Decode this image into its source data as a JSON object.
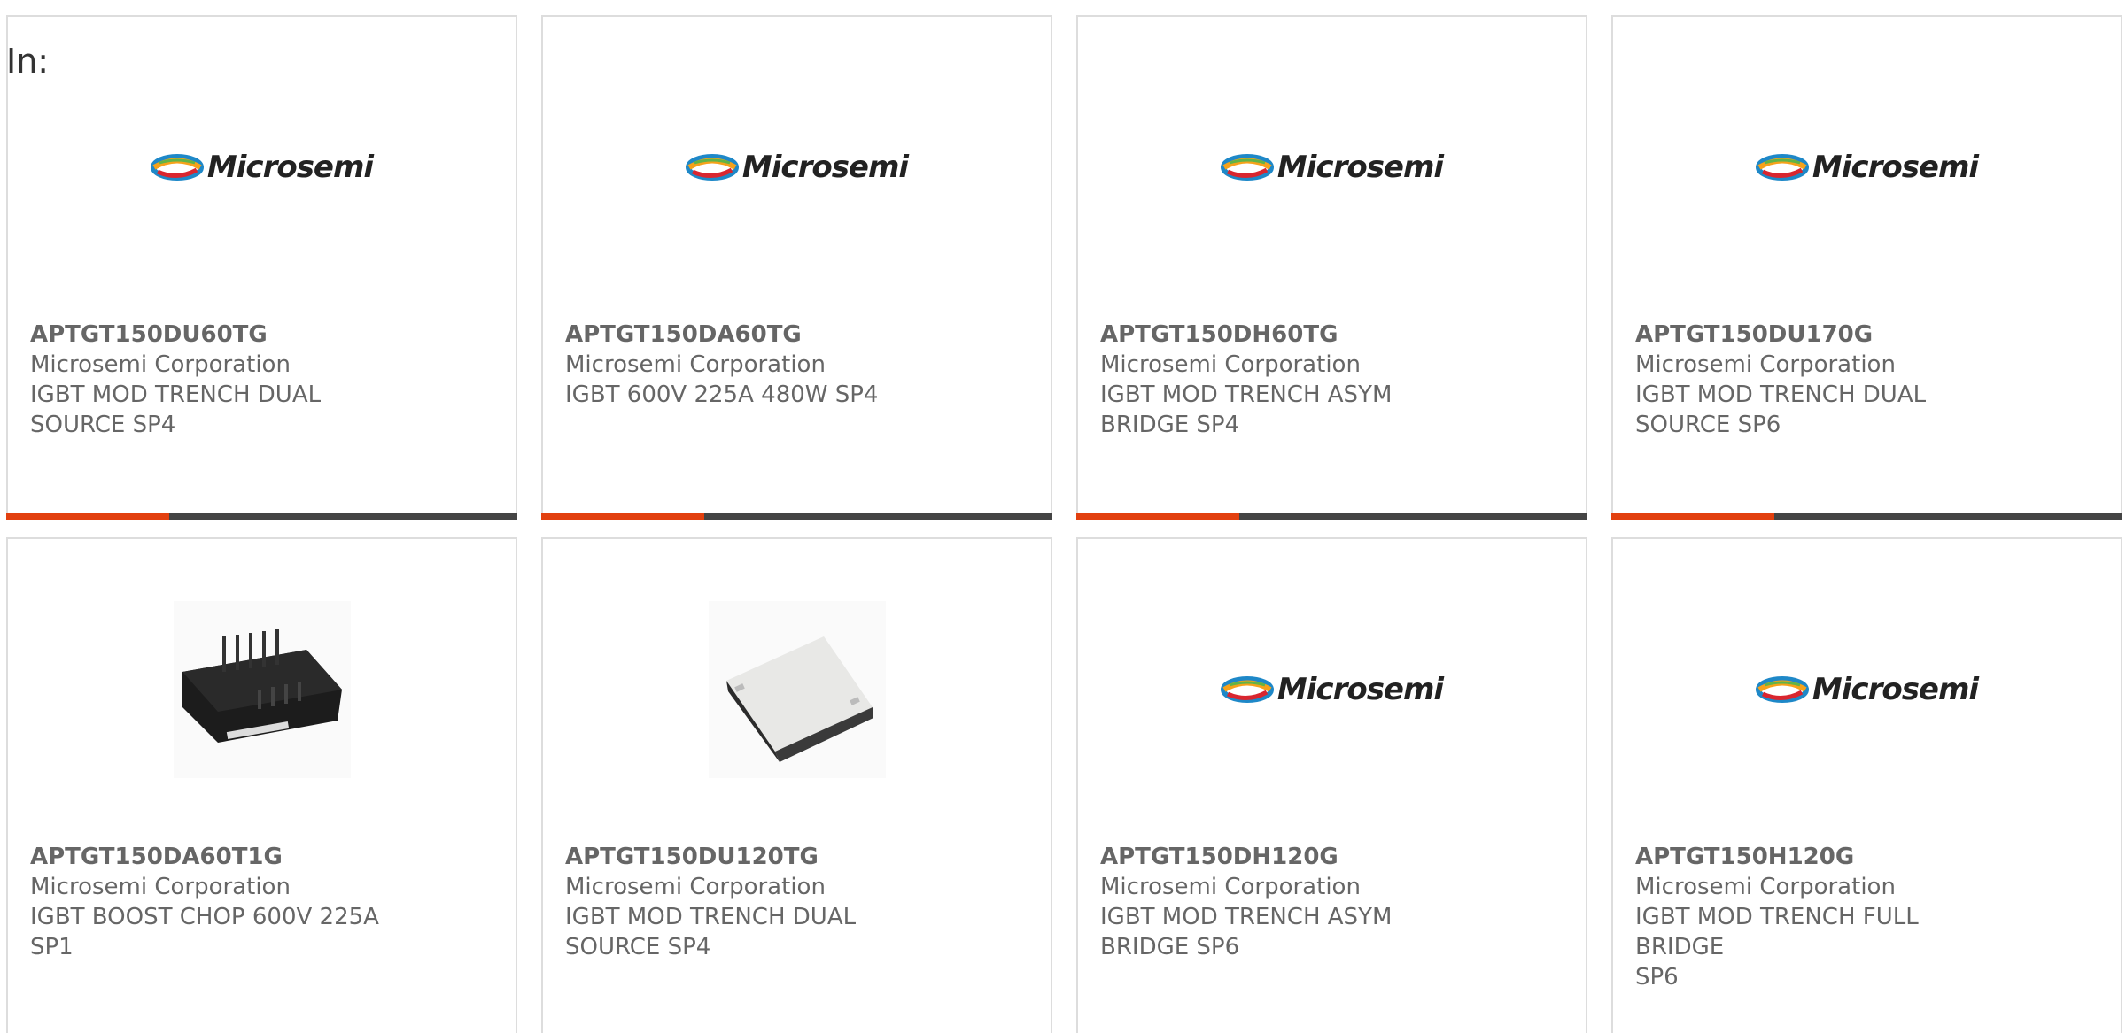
{
  "filter_label": "In:",
  "logo_text": "Microsemi",
  "colors": {
    "accent": "#e2400f",
    "bar": "#444444",
    "border": "#dddddd",
    "text": "#666666"
  },
  "products": [
    {
      "part": "APTGT150DU60TG",
      "mfr": "Microsemi Corporation",
      "desc_line1": "IGBT MOD TRENCH DUAL",
      "desc_line2": "SOURCE SP4",
      "image": "microsemi-logo"
    },
    {
      "part": "APTGT150DA60TG",
      "mfr": "Microsemi Corporation",
      "desc_line1": "IGBT 600V 225A 480W SP4",
      "desc_line2": "",
      "image": "microsemi-logo"
    },
    {
      "part": "APTGT150DH60TG",
      "mfr": "Microsemi Corporation",
      "desc_line1": "IGBT MOD TRENCH ASYM",
      "desc_line2": "BRIDGE SP4",
      "image": "microsemi-logo"
    },
    {
      "part": "APTGT150DU170G",
      "mfr": "Microsemi Corporation",
      "desc_line1": "IGBT MOD TRENCH DUAL",
      "desc_line2": "SOURCE SP6",
      "image": "microsemi-logo"
    },
    {
      "part": "APTGT150DA60T1G",
      "mfr": "Microsemi Corporation",
      "desc_line1": "IGBT BOOST CHOP 600V 225A",
      "desc_line2": "SP1",
      "image": "black-module-photo"
    },
    {
      "part": "APTGT150DU120TG",
      "mfr": "Microsemi Corporation",
      "desc_line1": "IGBT MOD TRENCH DUAL",
      "desc_line2": "SOURCE SP4",
      "image": "white-module-photo"
    },
    {
      "part": "APTGT150DH120G",
      "mfr": "Microsemi Corporation",
      "desc_line1": "IGBT MOD TRENCH ASYM",
      "desc_line2": "BRIDGE SP6",
      "image": "microsemi-logo"
    },
    {
      "part": "APTGT150H120G",
      "mfr": "Microsemi Corporation",
      "desc_line1": "IGBT MOD TRENCH FULL BRIDGE",
      "desc_line2": "SP6",
      "image": "microsemi-logo"
    }
  ]
}
